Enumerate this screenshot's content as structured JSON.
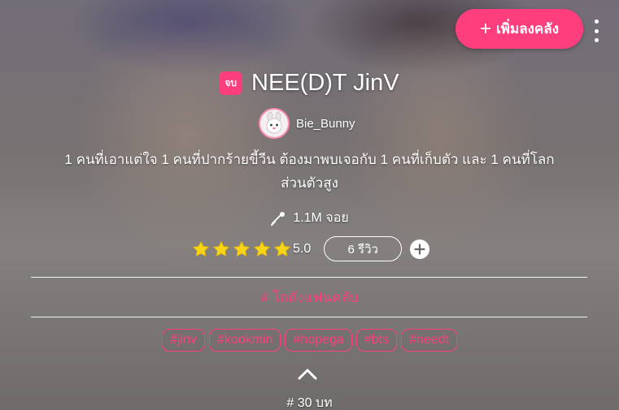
{
  "header": {
    "add_library_label": "เพิ่มลงคลัง",
    "add_icon": "plus-icon",
    "more_icon": "more-vertical-icon"
  },
  "novel": {
    "status_badge": "จบ",
    "title": "NEE(D)T JinV",
    "author": "Bie_Bunny",
    "description": "1 คนที่เอาแต่ใจ 1 คนที่ปากร้ายขี้วีน ต้องมาพบเจอกับ 1 คนที่เก็บตัว และ 1 คนที่โลกส่วนตัวสูง",
    "views": "1.1M จอย",
    "views_icon": "joy-icon",
    "rating": 5.0,
    "rating_text": "5.0",
    "reviews_label": "6 รีวิว",
    "category": "# โถดังแฟนคลับ",
    "tags": [
      "#jinv",
      "#kookmin",
      "#hopega",
      "#bts",
      "#needt"
    ],
    "chapters": "# 30 บท"
  },
  "colors": {
    "accent": "#ff3e7e",
    "star": "#f7d417",
    "text": "#ffffff"
  }
}
